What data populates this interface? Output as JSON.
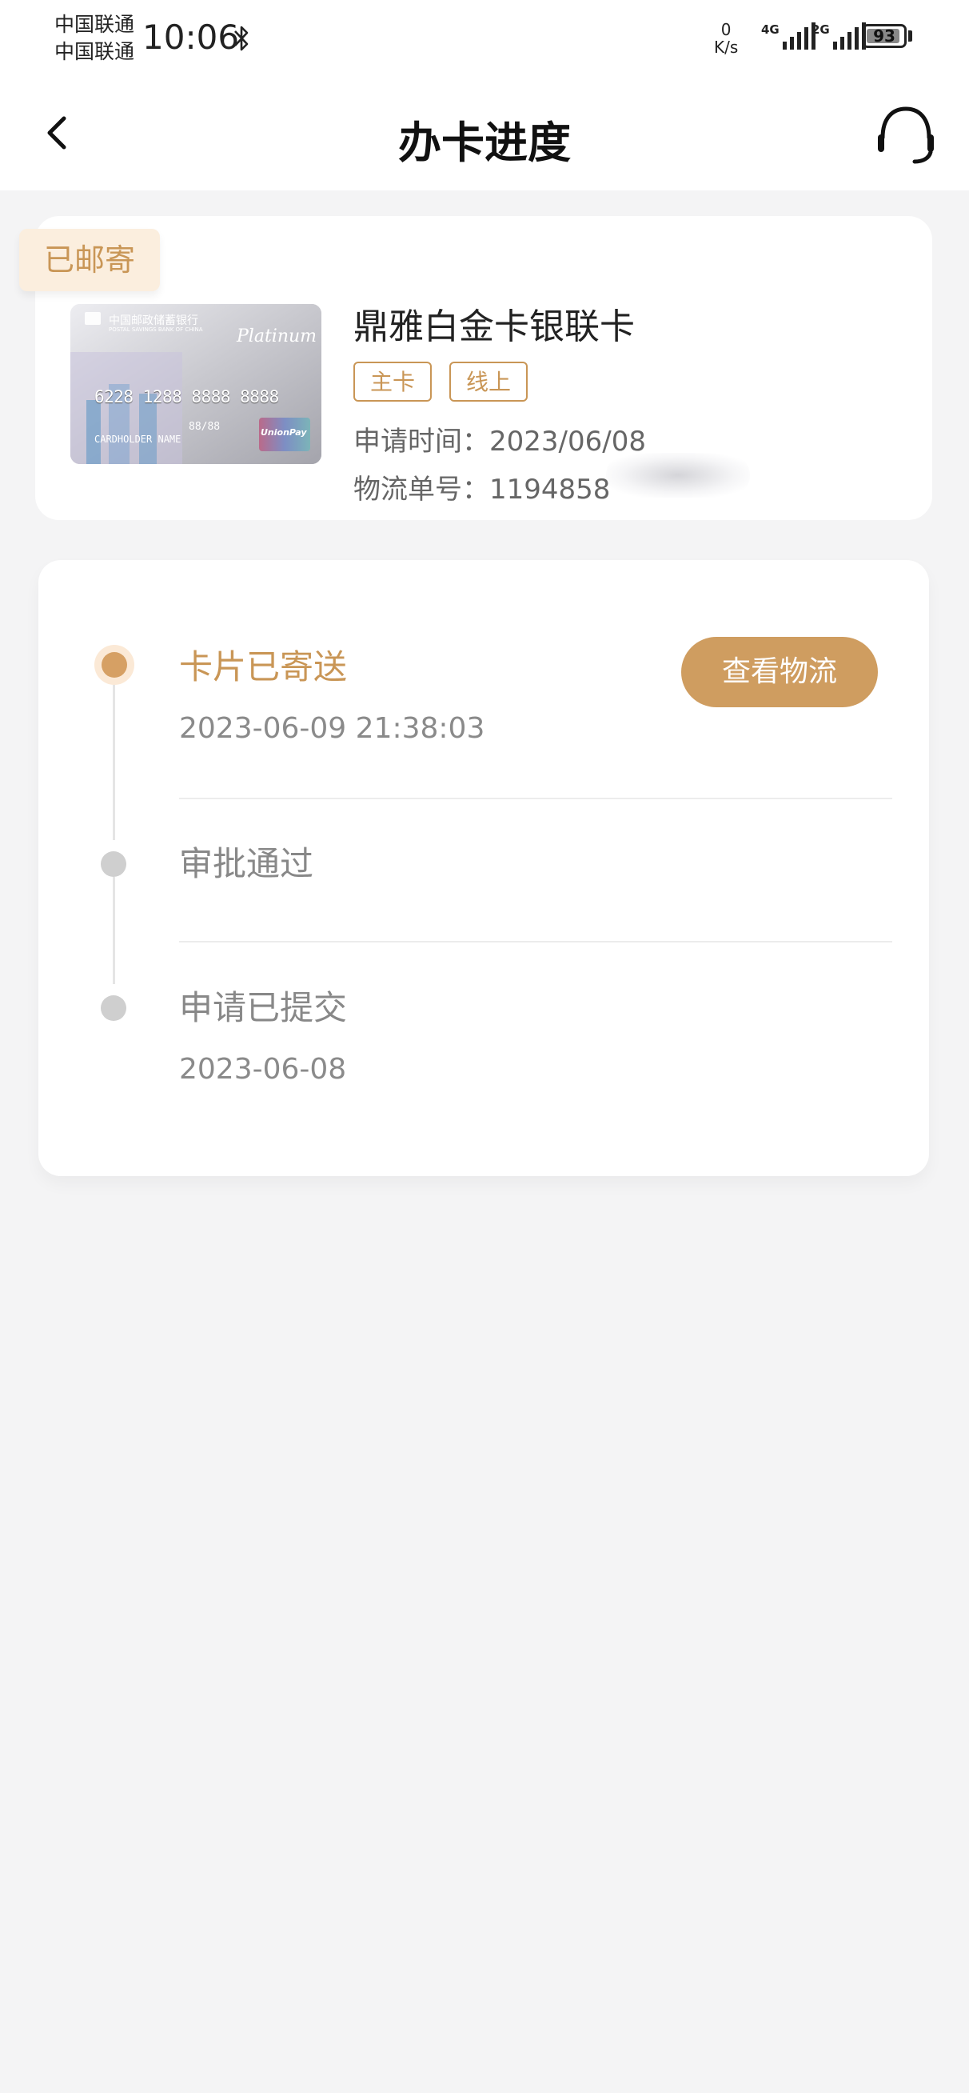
{
  "status_bar": {
    "carrier_1": "中国联通",
    "carrier_2": "中国联通",
    "time": "10:06",
    "net_speed_value": "0",
    "net_speed_unit": "K/s",
    "signal_1_label": "4G",
    "signal_2_label": "2G",
    "battery_level": "93"
  },
  "header": {
    "title": "办卡进度"
  },
  "card_summary": {
    "status_tag": "已邮寄",
    "card_name": "鼎雅白金卡银联卡",
    "tags": [
      "主卡",
      "线上"
    ],
    "apply_time_label": "申请时间：",
    "apply_time_value": "2023/06/08",
    "tracking_label": "物流单号：",
    "tracking_value": "1194858"
  },
  "card_image": {
    "bank_name": "中国邮政储蓄银行",
    "bank_name_en": "POSTAL SAVINGS BANK OF CHINA",
    "tier": "Platinum",
    "number": "6228 1288 8888 8888",
    "valid": "88/88",
    "holder": "CARDHOLDER NAME",
    "network": "UnionPay"
  },
  "timeline": {
    "view_logistics_label": "查看物流",
    "steps": [
      {
        "title": "卡片已寄送",
        "time": "2023-06-09 21:38:03",
        "active": true
      },
      {
        "title": "审批通过",
        "time": "",
        "active": false
      },
      {
        "title": "申请已提交",
        "time": "2023-06-08",
        "active": false
      }
    ]
  },
  "colors": {
    "accent": "#c99656",
    "button": "#cf9d60",
    "background": "#f4f4f5"
  }
}
